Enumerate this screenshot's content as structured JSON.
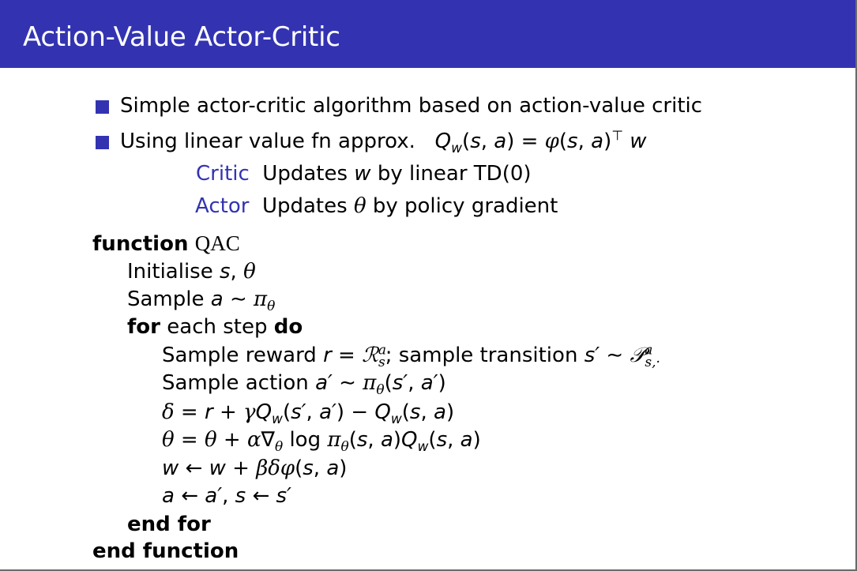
{
  "slide": {
    "title": "Action-Value Actor-Critic"
  },
  "bullets": [
    {
      "text": "Simple actor-critic algorithm based on action-value critic"
    },
    {
      "text": "Using linear value fn approx.",
      "formula": "Q_w(s, a) = φ(s, a)^⊤ w"
    }
  ],
  "components": [
    {
      "label": "Critic",
      "description": "Updates w by linear TD(0)"
    },
    {
      "label": "Actor",
      "description": "Updates θ by policy gradient"
    }
  ],
  "algorithm": {
    "function_keyword": "function",
    "function_name": "QAC",
    "lines": [
      "Initialise s, θ",
      "Sample a ∼ π_θ",
      "for each step do",
      "Sample reward r = R_s^a; sample transition s′ ∼ P_{s,·}^a",
      "Sample action a′ ∼ π_θ(s′, a′)",
      "δ = r + γQ_w(s′, a′) − Q_w(s, a)",
      "θ = θ + α∇_θ log π_θ(s, a)Q_w(s, a)",
      "w ← w + βδφ(s, a)",
      "a ← a′, s ← s′",
      "end for",
      "end function"
    ],
    "keywords": {
      "for": "for",
      "each_step": "each step",
      "do": "do",
      "end_for": "end for",
      "end_function": "end function"
    }
  },
  "colors": {
    "title_bar": "#3333b2",
    "bullet": "#3333b2",
    "accent_text": "#3333b2",
    "title_text": "#ffffff"
  }
}
